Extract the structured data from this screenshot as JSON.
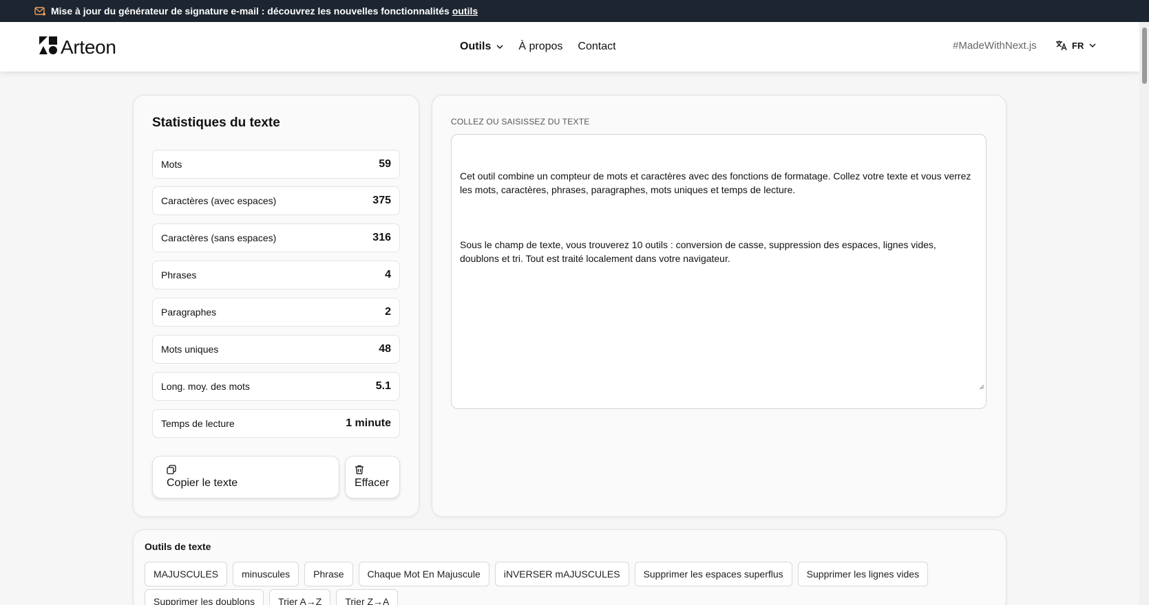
{
  "announcement": {
    "text": "Mise à jour du générateur de signature e-mail : découvrez les nouvelles fonctionnalités",
    "link": "outils"
  },
  "header": {
    "logo_text": "Arteon",
    "nav": [
      {
        "label": "Outils",
        "has_dropdown": true
      },
      {
        "label": "À propos"
      },
      {
        "label": "Contact"
      }
    ],
    "made_with": "#MadeWithNext.js",
    "lang": "FR"
  },
  "stats": {
    "title": "Statistiques du texte",
    "rows": [
      {
        "label": "Mots",
        "value": "59"
      },
      {
        "label": "Caractères (avec espaces)",
        "value": "375"
      },
      {
        "label": "Caractères (sans espaces)",
        "value": "316"
      },
      {
        "label": "Phrases",
        "value": "4"
      },
      {
        "label": "Paragraphes",
        "value": "2"
      },
      {
        "label": "Mots uniques",
        "value": "48"
      },
      {
        "label": "Long. moy. des mots",
        "value": "5.1"
      },
      {
        "label": "Temps de lecture",
        "value": "1 minute"
      }
    ],
    "copy_label": "Copier le texte",
    "clear_label": "Effacer"
  },
  "editor": {
    "label": "COLLEZ OU SAISISSEZ DU TEXTE",
    "paragraph1": "Cet outil combine un compteur de mots et caractères avec des fonctions de formatage. Collez votre texte et vous verrez les mots, caractères, phrases, paragraphes, mots uniques et temps de lecture.",
    "paragraph2": "Sous le champ de texte, vous trouverez 10 outils : conversion de casse, suppression des espaces, lignes vides, doublons et tri. Tout est traité localement dans votre navigateur."
  },
  "tools": {
    "title": "Outils de texte",
    "row1": [
      "MAJUSCULES",
      "minuscules",
      "Phrase",
      "Chaque Mot En Majuscule",
      "iNVERSER mAJUSCULES",
      "Supprimer les espaces superflus",
      "Supprimer les lignes vides"
    ],
    "row2": [
      "Supprimer les doublons",
      "Trier A→Z",
      "Trier Z→A"
    ]
  },
  "colors": {
    "announce_bg": "#1d2530",
    "accent_mail": "#e8a05a"
  }
}
